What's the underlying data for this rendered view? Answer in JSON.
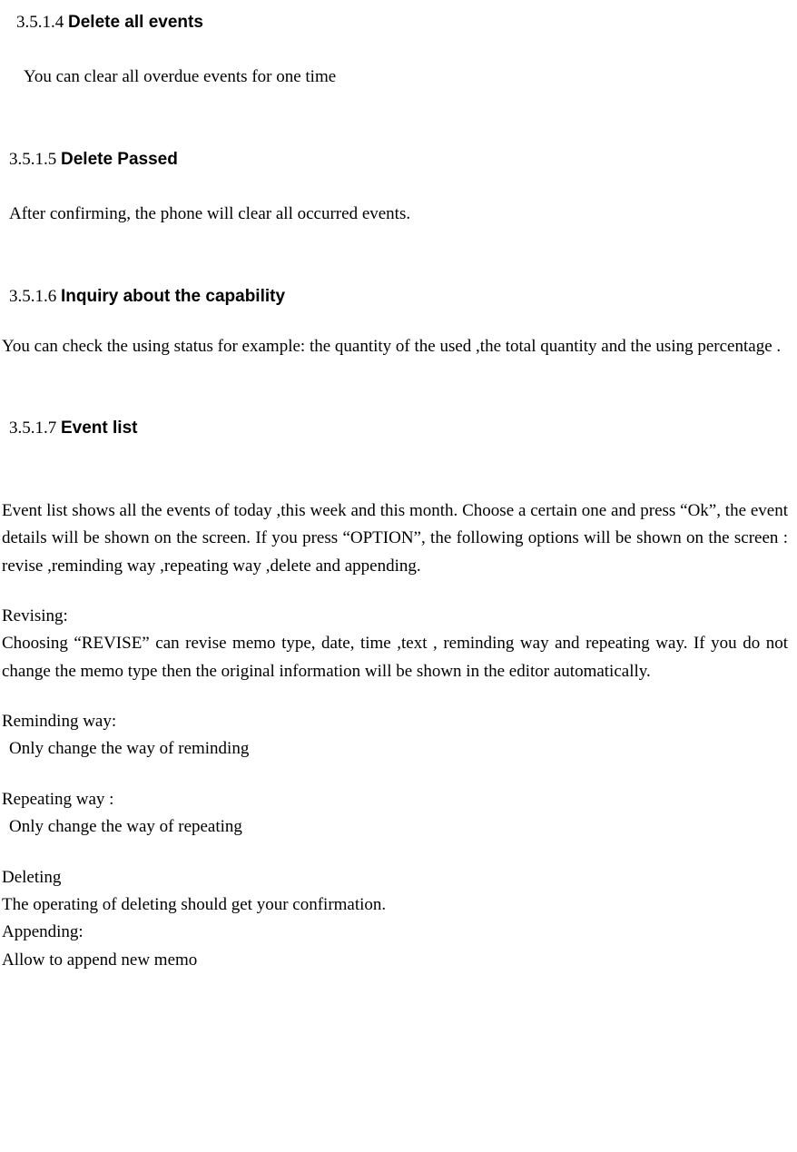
{
  "sections": {
    "s1": {
      "num": "3.5.1.4",
      "title": "Delete all events",
      "body": "You can clear all overdue events for one time"
    },
    "s2": {
      "num": "3.5.1.5",
      "title": "Delete Passed",
      "body": "After confirming, the phone will clear all occurred events."
    },
    "s3": {
      "num": "3.5.1.6",
      "title": "Inquiry about the capability",
      "body": "You can check the using status for example: the quantity of the used  ,the total quantity and the using percentage ."
    },
    "s4": {
      "num": "3.5.1.7",
      "title": "Event list",
      "intro": "Event list shows all the events of today  ,this week and this month. Choose a certain one and press “Ok”, the event details will be shown on the screen. If you press “OPTION”, the following options will be shown on the screen : revise ,reminding way ,repeating way ,delete and appending.",
      "revising": {
        "label": "Revising:",
        "body": "Choosing “REVISE” can revise memo type, date, time ,text , reminding way and repeating way. If you do not change the memo type then the original information will be shown in the editor automatically."
      },
      "reminding": {
        "label": "Reminding way:",
        "body": "Only change the way of reminding"
      },
      "repeating": {
        "label": "Repeating way :",
        "body": "Only change the way of repeating"
      },
      "deleting": {
        "label": "Deleting",
        "body": "The operating of deleting should get your confirmation."
      },
      "appending": {
        "label": "Appending:",
        "body": "Allow to append new memo"
      }
    }
  }
}
